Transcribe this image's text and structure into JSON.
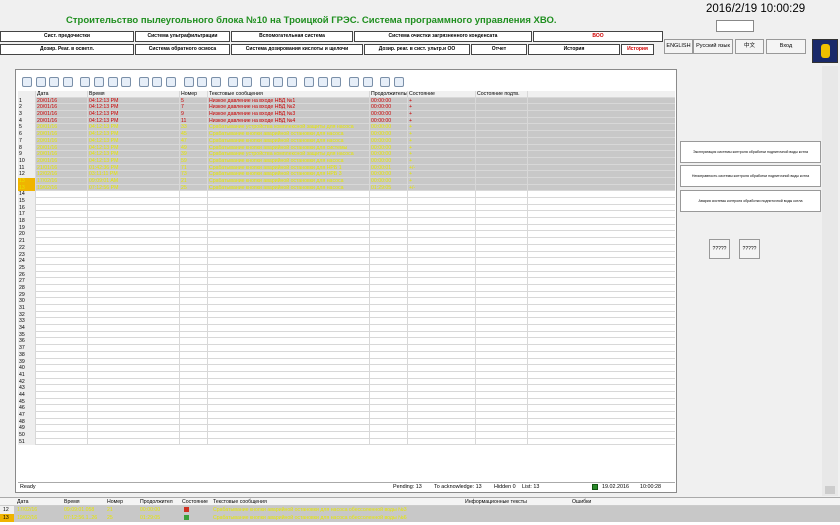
{
  "header": {
    "title": "Строительство пылеугольного блока №10 на Троицкой ГРЭС. Система программного управления ХВО.",
    "clock": "2016/2/19 10:00:29"
  },
  "nav_row1": [
    "Сист. предочистки",
    "Система ультрафильтрации",
    "Вспомогательная система",
    "Система очистки загрязненного конденсата",
    "ВОО"
  ],
  "nav_row2": [
    "Дозир. Реаг. в осветл.",
    "Система обратного осмоса",
    "Система дозирования кислоты и щелочи",
    "Дозир. реаг. в сист. ультр.и ОО",
    "Отчет",
    "История",
    "История"
  ],
  "lang": {
    "english": "ENGLISH",
    "russian": "Русский язык",
    "chinese": "中文",
    "exit": "Вход"
  },
  "grid": {
    "columns": [
      "Дата",
      "Время",
      "Номер",
      "Текстовые сообщения",
      "Продолжительн",
      "Состояние",
      "Состояние подтв."
    ],
    "rows": [
      {
        "n": "1",
        "date": "20/01/16",
        "time": "04:12:13 PM",
        "num": "5",
        "msg": "Низкое давление на входе НВД №1",
        "dur": "00:00:00",
        "state": "+",
        "ack": "",
        "style": "red"
      },
      {
        "n": "2",
        "date": "20/01/16",
        "time": "04:12:13 PM",
        "num": "7",
        "msg": "Низкое давление на входе НВД №2",
        "dur": "00:00:00",
        "state": "+",
        "ack": "",
        "style": "red"
      },
      {
        "n": "3",
        "date": "20/01/16",
        "time": "04:12:13 PM",
        "num": "9",
        "msg": "Низкое давление на входе НВД №3",
        "dur": "00:00:00",
        "state": "+",
        "ack": "",
        "style": "red"
      },
      {
        "n": "4",
        "date": "20/01/16",
        "time": "04:12:13 PM",
        "num": "11",
        "msg": "Низкое давление на входе НВД №4",
        "dur": "00:00:00",
        "state": "+",
        "ack": "",
        "style": "red"
      },
      {
        "n": "5",
        "date": "20/01/16",
        "time": "04:12:13 PM",
        "num": "33",
        "msg": "Срабатывание устройства комплексной защиты для насоса",
        "dur": "00:00:00",
        "state": "+",
        "ack": "",
        "style": "yel"
      },
      {
        "n": "6",
        "date": "20/01/16",
        "time": "04:12:13 PM",
        "num": "45",
        "msg": "Срабатывание кнопки аварийной остановки для насоса",
        "dur": "00:00:00",
        "state": "+",
        "ack": "",
        "style": "yel"
      },
      {
        "n": "7",
        "date": "20/01/16",
        "time": "04:12:13 PM",
        "num": "47",
        "msg": "Срабатывание кнопки аварийной остановки для насоса",
        "dur": "00:00:00",
        "state": "+",
        "ack": "",
        "style": "yel"
      },
      {
        "n": "8",
        "date": "20/01/16",
        "time": "04:12:13 PM",
        "num": "49",
        "msg": "Срабатывание кнопки аварийной остановки для системы",
        "dur": "00:00:00",
        "state": "+",
        "ack": "",
        "style": "yel"
      },
      {
        "n": "9",
        "date": "20/01/16",
        "time": "04:12:13 PM",
        "num": "39",
        "msg": "Срабатывание устройства комплексной защиты для насоса",
        "dur": "00:00:00",
        "state": "+",
        "ack": "",
        "style": "yel"
      },
      {
        "n": "10",
        "date": "20/01/16",
        "time": "04:12:13 PM",
        "num": "59",
        "msg": "Срабатывание кнопки аварийной остановки для насоса",
        "dur": "00:00:00",
        "state": "+",
        "ack": "",
        "style": "yel"
      },
      {
        "n": "11",
        "date": "21/01/16",
        "time": "01:42:36 PM",
        "num": "71",
        "msg": "Срабатывание кнопки аварийной остановки для НРБ 1",
        "dur": "00:00:01",
        "state": "+/-",
        "ack": "",
        "style": "yel"
      },
      {
        "n": "12",
        "date": "12/02/16",
        "time": "03:11:11 PM",
        "num": "73",
        "msg": "Срабатывание кнопки аварийной остановки для НРБ 3",
        "dur": "00:00:00",
        "state": "+",
        "ack": "",
        "style": "yel"
      },
      {
        "n": "13",
        "date": "17/02/16",
        "time": "09:09:01 AM",
        "num": "21",
        "msg": "Срабатывание кнопки аварийной остановки для насоса",
        "dur": "00:00:00",
        "state": "+",
        "ack": "",
        "style": "sel"
      },
      {
        "n": "13",
        "date": "19/02/16",
        "time": "07:12:56 PM",
        "num": "25",
        "msg": "Срабатывание кнопки аварийной остановки для насоса",
        "dur": "01:29:05",
        "state": "+/-",
        "ack": "",
        "style": "sel"
      }
    ],
    "empty_rows": [
      "14",
      "15",
      "16",
      "17",
      "18",
      "19",
      "20",
      "21",
      "22",
      "23",
      "24",
      "25",
      "26",
      "27",
      "28",
      "29",
      "30",
      "31",
      "32",
      "33",
      "34",
      "35",
      "36",
      "37",
      "38",
      "39",
      "40",
      "41",
      "42",
      "43",
      "44",
      "45",
      "46",
      "47",
      "48",
      "49",
      "50",
      "51"
    ]
  },
  "status": {
    "ready": "Ready",
    "pending": "Pending: 13",
    "ack": "To acknowledge: 13",
    "hidden": "Hidden 0",
    "list": "List: 13",
    "date": "19.02.2016",
    "time": "10:00:28"
  },
  "side_buttons": [
    "Эксплуатация системы контроля обработки подпиточной воды котла",
    "Неисправность системы контроля обработки подпиточной воды котла",
    "Авария системы контроля обработки подпиточной воды котла"
  ],
  "q_buttons": [
    "?????",
    "?????"
  ],
  "bottom": {
    "columns": [
      "",
      "Дата",
      "Время",
      "Номер",
      "Продолжител",
      "Состояние",
      "Текстовые сообщения",
      "Информационные тексты",
      "Ошибки"
    ],
    "rows": [
      {
        "n": "12",
        "date": "17/02/16",
        "time": "09:09:01.058",
        "num": "21",
        "dur": "00:00:00",
        "msg": "Срабатывание кнопки аварийной остановки для насоса обессоленной воды №3",
        "state_color": "#d03020"
      },
      {
        "n": "13",
        "date": "19/02/16",
        "time": "07:12:56.1..26",
        "num": "25",
        "dur": "01:29:05",
        "msg": "Срабатывание кнопки аварийной остановки для насоса обессоленной воды №6",
        "state_color": "#3aa03a"
      }
    ]
  },
  "colors": {
    "title": "#1f8f1f",
    "alarm_red": "#cc0000",
    "warn_yellow": "#e6e600",
    "row_bg": "#c8c8c8",
    "selected": "#f0b400"
  },
  "toolbar_icons": [
    "help-icon",
    "filter-icon",
    "refresh-icon",
    "print-preview-icon",
    "export-icon",
    "sort-icon",
    "lock-icon",
    "table-icon",
    "move-down-icon",
    "settings-icon",
    "chart-icon",
    "archive-icon",
    "copy-icon",
    "report-icon",
    "save-icon",
    "print-icon",
    "flag-icon",
    "next-icon",
    "prev-icon",
    "export2-icon",
    "import-icon",
    "page-icon",
    "filter2-icon",
    "lock2-icon",
    "options-icon",
    "history-icon"
  ]
}
